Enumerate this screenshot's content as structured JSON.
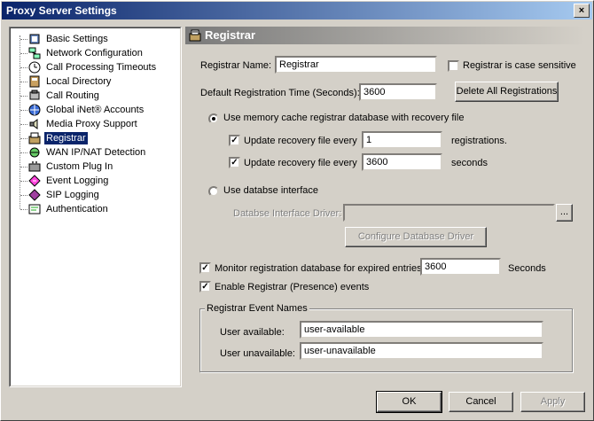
{
  "window": {
    "title": "Proxy Server Settings",
    "close_glyph": "×"
  },
  "tree": {
    "items": [
      {
        "label": "Basic Settings",
        "icon": "settings-icon"
      },
      {
        "label": "Network Configuration",
        "icon": "network-icon"
      },
      {
        "label": "Call Processing Timeouts",
        "icon": "clock-icon"
      },
      {
        "label": "Local Directory",
        "icon": "directory-icon"
      },
      {
        "label": "Call Routing",
        "icon": "phone-icon"
      },
      {
        "label": "Global iNet® Accounts",
        "icon": "accounts-icon"
      },
      {
        "label": "Media Proxy Support",
        "icon": "speaker-icon"
      },
      {
        "label": "Registrar",
        "icon": "registrar-icon",
        "selected": true
      },
      {
        "label": "WAN IP/NAT Detection",
        "icon": "wan-icon"
      },
      {
        "label": "Custom Plug In",
        "icon": "plugin-icon"
      },
      {
        "label": "Event Logging",
        "icon": "event-log-icon"
      },
      {
        "label": "SIP Logging",
        "icon": "sip-log-icon"
      },
      {
        "label": "Authentication",
        "icon": "authentication-icon"
      }
    ]
  },
  "panel": {
    "title": "Registrar",
    "registrar_name_label": "Registrar Name:",
    "registrar_name_value": "Registrar",
    "case_sensitive_label": "Registrar is case sensitive",
    "case_sensitive_checked": false,
    "default_time_label": "Default Registration Time (Seconds):",
    "default_time_value": "3600",
    "delete_all_label": "Delete All Registrations",
    "memory_cache_label": "Use memory cache registrar database with recovery file",
    "memory_cache_selected": true,
    "update_every_label": "Update recovery file every",
    "update_regs_value": "1",
    "update_regs_unit": "registrations.",
    "update_regs_checked": true,
    "update_secs_value": "3600",
    "update_secs_unit": "seconds",
    "update_secs_checked": true,
    "database_label": "Use databse interface",
    "database_selected": false,
    "driver_label": "Databse Interface Driver:",
    "driver_value": "",
    "browse_label": "...",
    "configure_driver_label": "Configure Database Driver",
    "monitor_label": "Monitor registration database for expired entries",
    "monitor_checked": true,
    "monitor_value": "3600",
    "monitor_unit": "Seconds",
    "enable_events_label": "Enable Registrar (Presence) events",
    "enable_events_checked": true,
    "event_names": {
      "group_title": "Registrar Event Names",
      "available_label": "User available:",
      "available_value": "user-available",
      "unavailable_label": "User unavailable:",
      "unavailable_value": "user-unavailable"
    }
  },
  "footer": {
    "ok_label": "OK",
    "cancel_label": "Cancel",
    "apply_label": "Apply"
  },
  "check_glyph": "✓"
}
